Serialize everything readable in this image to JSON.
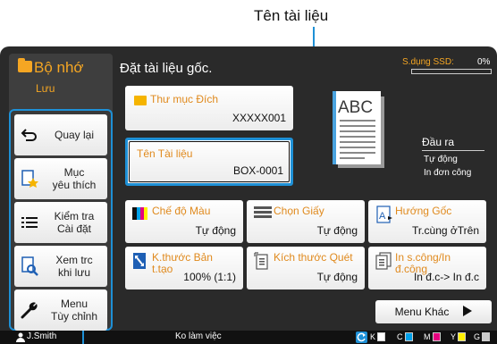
{
  "callout": {
    "label": "Tên tài liệu"
  },
  "mode": {
    "title": "Bộ nhớ",
    "subtitle": "Lưu"
  },
  "instruction": "Đặt tài liệu gốc.",
  "ssd": {
    "label": "S.dụng SSD:",
    "value": "0%"
  },
  "sidebar": {
    "items": [
      {
        "label_line1": "Quay lại",
        "label_line2": "",
        "icon": "back-arrow-icon"
      },
      {
        "label_line1": "Mục",
        "label_line2": "yêu thích",
        "icon": "favorite-star-icon"
      },
      {
        "label_line1": "Kiểm tra",
        "label_line2": "Cài đặt",
        "icon": "list-icon"
      },
      {
        "label_line1": "Xem trc",
        "label_line2": "khi lưu",
        "icon": "preview-search-icon"
      },
      {
        "label_line1": "Menu",
        "label_line2": "Tùy chỉnh",
        "icon": "wrench-icon"
      }
    ]
  },
  "destination": {
    "title": "Thư mục Đích",
    "value": "XXXXX001"
  },
  "document": {
    "title": "Tên Tài liệu",
    "value": "BOX-0001"
  },
  "output": {
    "title": "Đầu ra",
    "line1": "Tự động",
    "line2": "In đơn công"
  },
  "settings": [
    {
      "title_line1": "Chế độ Màu",
      "title_line2": "",
      "value": "Tự động",
      "icon": "color-mode-icon"
    },
    {
      "title_line1": "Chọn Giấy",
      "title_line2": "",
      "value": "Tự động",
      "icon": "paper-tray-icon"
    },
    {
      "title_line1": "Hướng Gốc",
      "title_line2": "",
      "value": "Tr.cùng ởTrên",
      "icon": "orientation-icon"
    },
    {
      "title_line1": "K.thước Bản",
      "title_line2": "t.tạo",
      "value": "100% (1:1)",
      "icon": "reproduction-size-icon"
    },
    {
      "title_line1": "Kích thước Quét",
      "title_line2": "",
      "value": "Tự động",
      "icon": "scan-size-icon"
    },
    {
      "title_line1": "In s.công/In",
      "title_line2": "đ.công",
      "value": "In đ.c-> In đ.c",
      "icon": "duplex-icon"
    }
  ],
  "more_menu": {
    "label": "Menu Khác"
  },
  "status": {
    "user": "J.Smith",
    "work": "Ko làm việc",
    "inks": [
      {
        "name": "K",
        "color": "#ffffff"
      },
      {
        "name": "C",
        "color": "#00a0e9"
      },
      {
        "name": "M",
        "color": "#e4007f"
      },
      {
        "name": "Y",
        "color": "#fff100"
      },
      {
        "name": "G",
        "color": "#cccccc"
      }
    ]
  },
  "colors": {
    "accent": "#f5a623",
    "highlight": "#1e90d6",
    "background": "#2a2a2a"
  }
}
